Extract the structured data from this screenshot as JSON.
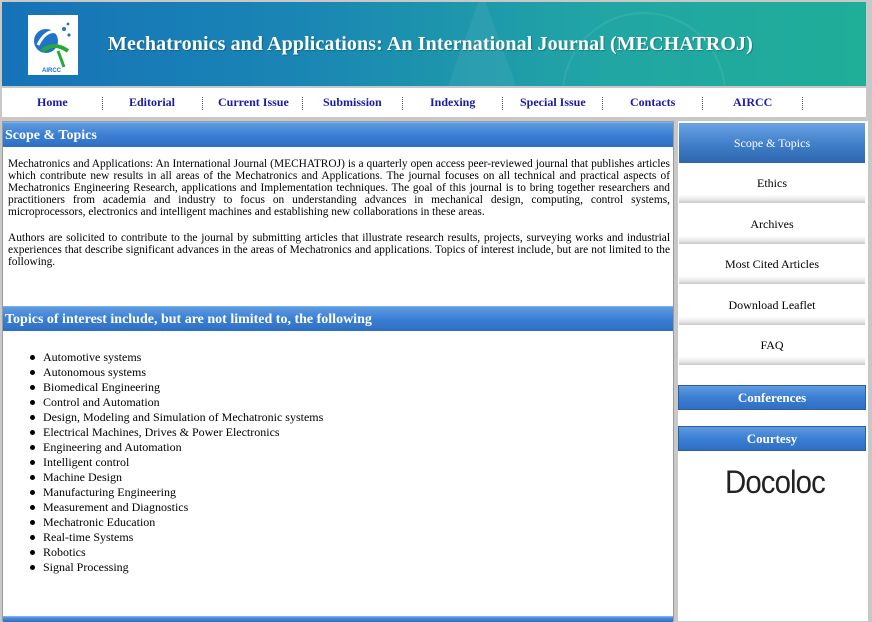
{
  "header": {
    "title": "Mechatronics and Applications: An International Journal (MECHATROJ)",
    "logo_text": "AIRCC"
  },
  "nav": {
    "items": [
      "Home",
      "Editorial",
      "Current Issue",
      "Submission",
      "Indexing",
      "Special Issue",
      "Contacts",
      "AIRCC"
    ]
  },
  "main": {
    "scope_heading": "Scope & Topics",
    "paragraph1": "Mechatronics and Applications: An International Journal (MECHATROJ) is a quarterly open access peer-reviewed journal that publishes articles which contribute new results in all areas of the Mechatronics and Applications.  The journal focuses on all technical and practical aspects of Mechatronics Engineering Research, applications and Implementation techniques. The goal of this journal is to bring together researchers and practitioners from academia and industry to focus on understanding advances in mechanical design, computing, control systems, microprocessors, electronics and intelligent machines and establishing new collaborations in these areas.",
    "paragraph2": "Authors are solicited to contribute to the journal by submitting articles that illustrate research results, projects, surveying works and industrial experiences that describe significant advances in the areas of Mechatronics and applications. Topics of interest include, but are not limited to the following.",
    "topics_heading": "Topics of interest include, but are not limited to, the following",
    "topics": [
      "Automotive systems",
      "Autonomous systems",
      "Biomedical Engineering",
      "Control and Automation",
      "Design, Modeling and Simulation of Mechatronic systems",
      "Electrical Machines, Drives & Power Electronics",
      "Engineering and Automation",
      "Intelligent control",
      "Machine Design",
      "Manufacturing Engineering",
      "Measurement and Diagnostics",
      "Mechatronic Education",
      "Real-time Systems",
      "Robotics",
      "Signal Processing"
    ]
  },
  "sidebar": {
    "items": [
      "Scope & Topics",
      "Ethics",
      "Archives",
      "Most Cited Articles",
      "Download Leaflet",
      "FAQ"
    ],
    "conferences_heading": "Conferences",
    "courtesy_heading": "Courtesy",
    "courtesy_logo": "Docoloc"
  },
  "colors": {
    "nav_link": "#1a1aa8",
    "section_blue": "#3b7fd4",
    "header_start": "#1672b8",
    "header_end": "#1fae98"
  }
}
